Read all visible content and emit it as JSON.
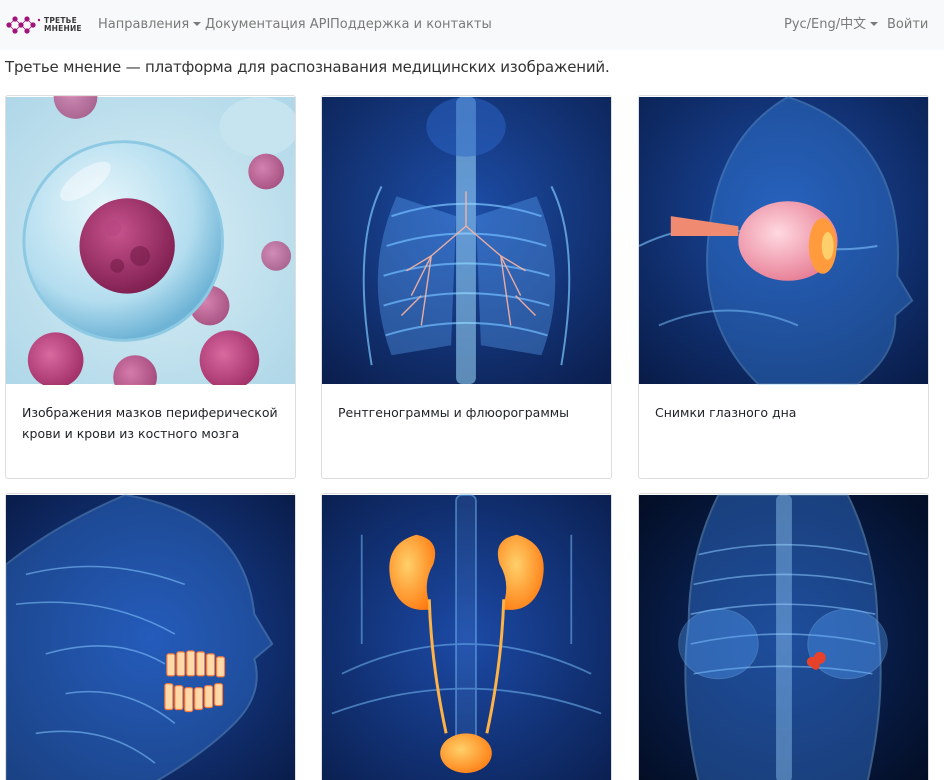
{
  "brand": {
    "line1": "ТРЕТЬЕ",
    "line2": "МНЕНИЕ"
  },
  "nav": {
    "directions": "Направления",
    "api_docs": "Документация API",
    "support": "Поддержка и контакты",
    "language": "Рус/Eng/中文",
    "login": "Войти"
  },
  "tagline": "Третье мнение — платформа для распознавания медицинских изображений.",
  "cards": [
    {
      "title": "Изображения мазков периферической крови и крови из костного мозга",
      "image": "blood-cell-illustration"
    },
    {
      "title": "Рентгенограммы и флюорограммы",
      "image": "lungs-xray-illustration"
    },
    {
      "title": "Снимки глазного дна",
      "image": "eye-fundus-illustration"
    },
    {
      "title": "",
      "image": "dental-xray-illustration"
    },
    {
      "title": "",
      "image": "kidneys-illustration"
    },
    {
      "title": "",
      "image": "body-xray-illustration"
    }
  ],
  "colors": {
    "brand_purple": "#a0147c",
    "navbar_bg": "#f8f9fa",
    "xray_blue": "#2a6fd8",
    "organ_orange": "#ff8a1e"
  }
}
